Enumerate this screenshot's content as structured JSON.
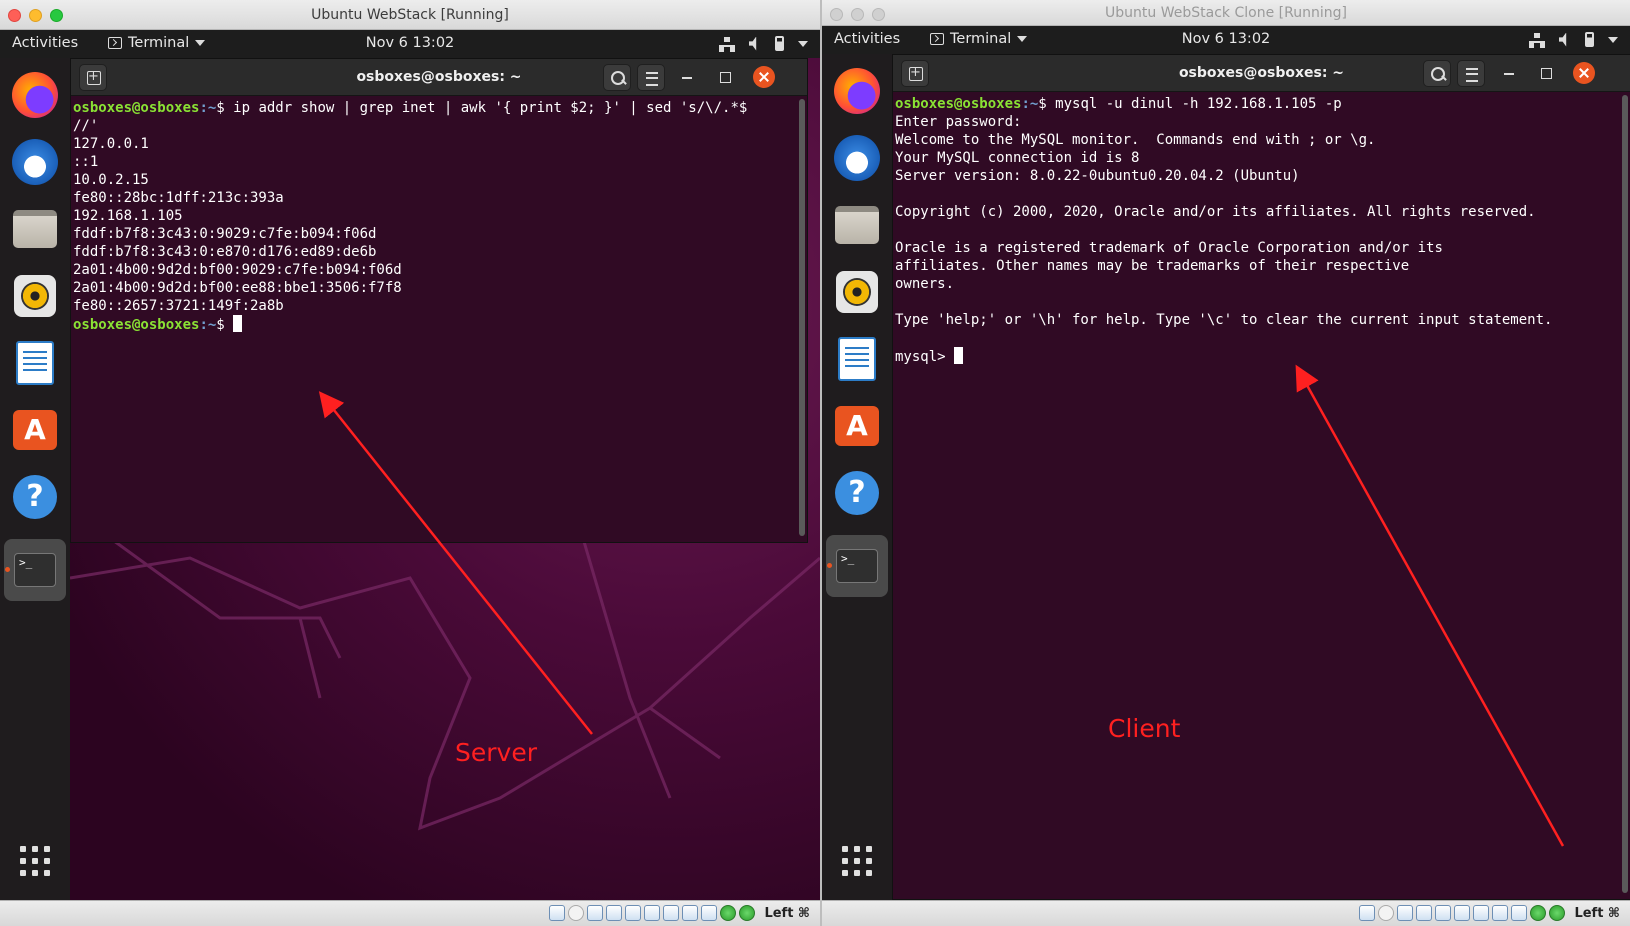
{
  "server": {
    "window_title": "Ubuntu WebStack [Running]",
    "topbar": {
      "activities": "Activities",
      "app_menu": "Terminal",
      "clock": "Nov 6  13:02"
    },
    "terminal": {
      "title": "osboxes@osboxes: ~",
      "prompt_user": "osboxes@osboxes",
      "prompt_path": ":~",
      "prompt_symbol": "$ ",
      "command": "ip addr show | grep inet | awk '{ print $2; }' | sed 's/\\/.*$",
      "command_cont": "//'",
      "output": [
        "127.0.0.1",
        "::1",
        "10.0.2.15",
        "fe80::28bc:1dff:213c:393a",
        "192.168.1.105",
        "fddf:b7f8:3c43:0:9029:c7fe:b094:f06d",
        "fddf:b7f8:3c43:0:e870:d176:ed89:de6b",
        "2a01:4b00:9d2d:bf00:9029:c7fe:b094:f06d",
        "2a01:4b00:9d2d:bf00:ee88:bbe1:3506:f7f8",
        "fe80::2657:3721:149f:2a8b"
      ]
    },
    "status_host_key": "Left ⌘",
    "annotation": "Server"
  },
  "client": {
    "window_title": "Ubuntu WebStack Clone [Running]",
    "topbar": {
      "activities": "Activities",
      "app_menu": "Terminal",
      "clock": "Nov 6  13:02"
    },
    "terminal": {
      "title": "osboxes@osboxes: ~",
      "prompt_user": "osboxes@osboxes",
      "prompt_path": ":~",
      "prompt_symbol": "$ ",
      "command": "mysql -u dinul -h 192.168.1.105 -p",
      "output": [
        "Enter password:",
        "Welcome to the MySQL monitor.  Commands end with ; or \\g.",
        "Your MySQL connection id is 8",
        "Server version: 8.0.22-0ubuntu0.20.04.2 (Ubuntu)",
        "",
        "Copyright (c) 2000, 2020, Oracle and/or its affiliates. All rights reserved.",
        "",
        "Oracle is a registered trademark of Oracle Corporation and/or its",
        "affiliates. Other names may be trademarks of their respective",
        "owners.",
        "",
        "Type 'help;' or '\\h' for help. Type '\\c' to clear the current input statement.",
        ""
      ],
      "mysql_prompt": "mysql> "
    },
    "status_host_key": "Left ⌘",
    "annotation": "Client"
  },
  "dock_items": [
    "firefox-icon",
    "thunderbird-icon",
    "files-icon",
    "rhythmbox-icon",
    "writer-icon",
    "software-icon",
    "help-icon",
    "terminal-icon",
    "show-apps-icon"
  ],
  "colors": {
    "terminal_bg": "#300a24",
    "prompt_user": "#8ae234",
    "prompt_path": "#729fcf",
    "accent": "#e95420",
    "annotation": "#ff2020"
  }
}
